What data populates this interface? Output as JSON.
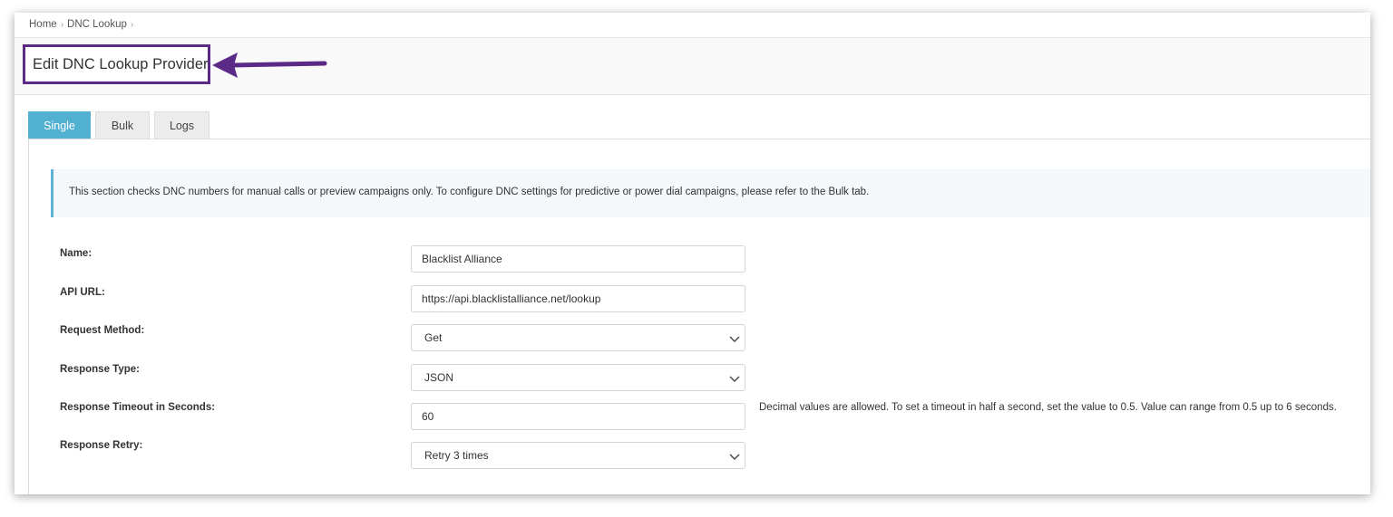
{
  "breadcrumb": {
    "items": [
      "Home",
      "DNC Lookup"
    ]
  },
  "page_title": "Edit DNC Lookup Provider",
  "tabs": [
    {
      "label": "Single",
      "active": true
    },
    {
      "label": "Bulk",
      "active": false
    },
    {
      "label": "Logs",
      "active": false
    }
  ],
  "info_text": "This section checks DNC numbers for manual calls or preview campaigns only. To configure DNC settings for predictive or power dial campaigns, please refer to the Bulk tab.",
  "form": {
    "name": {
      "label": "Name:",
      "value": "Blacklist Alliance"
    },
    "api_url": {
      "label": "API URL:",
      "value": "https://api.blacklistalliance.net/lookup"
    },
    "request_method": {
      "label": "Request Method:",
      "value": "Get"
    },
    "response_type": {
      "label": "Response Type:",
      "value": "JSON"
    },
    "response_timeout": {
      "label": "Response Timeout in Seconds:",
      "value": "60",
      "help": "Decimal values are allowed. To set a timeout in half a second, set the value to 0.5. Value can range from 0.5 up to 6 seconds."
    },
    "response_retry": {
      "label": "Response Retry:",
      "value": "Retry 3 times"
    }
  },
  "colors": {
    "annotation": "#5b2a86",
    "tab_active": "#52b0d1",
    "info_border": "#5fb3d8"
  },
  "icons": {
    "breadcrumb_separator": "chevron-right-icon",
    "select_arrow": "chevron-down-icon",
    "annotation_arrow": "arrow-left-icon"
  }
}
